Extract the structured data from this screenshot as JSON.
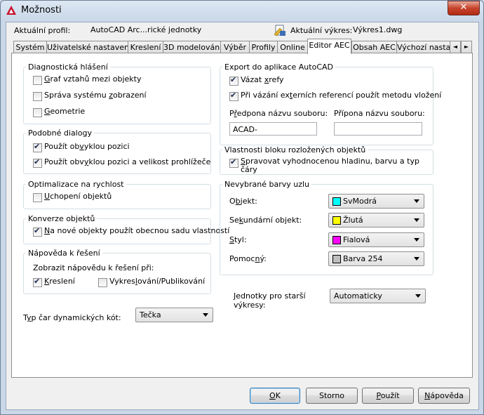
{
  "window": {
    "title": "Možnosti",
    "close_glyph": "✕"
  },
  "header": {
    "profile_label": "Aktuální profil:",
    "profile_value": "AutoCAD Arc...rické jednotky",
    "drawing_label": "Aktuální výkres:",
    "drawing_value": "Výkres1.dwg"
  },
  "tabs": [
    {
      "label": "Systém"
    },
    {
      "label": "Uživatelské nastavení"
    },
    {
      "label": "Kreslení"
    },
    {
      "label": "3D modelování"
    },
    {
      "label": "Výběr"
    },
    {
      "label": "Profily"
    },
    {
      "label": "Online"
    },
    {
      "label": "Editor AEC",
      "active": true
    },
    {
      "label": "Obsah AEC"
    },
    {
      "label": "Výchozí nastavení"
    }
  ],
  "tab_scroll": {
    "left": "◄",
    "right": "►"
  },
  "diag": {
    "title": "Diagnostická hlášení",
    "items": [
      {
        "pre": "",
        "ul": "G",
        "post": "raf vztahů mezi objekty",
        "checked": false
      },
      {
        "pre": "Správa systému ",
        "ul": "z",
        "post": "obrazení",
        "checked": false
      },
      {
        "pre": "",
        "ul": "G",
        "post": "eometrie",
        "checked": false
      }
    ]
  },
  "similar": {
    "title": "Podobné dialogy",
    "items": [
      {
        "pre": "Použít ob",
        "ul": "v",
        "post": "yklou pozici",
        "checked": true
      },
      {
        "pre": "Použít obv",
        "ul": "y",
        "post": "klou pozici a velikost prohlížeče",
        "checked": true
      }
    ]
  },
  "optim": {
    "title": "Optimalizace na rychlost",
    "items": [
      {
        "pre": "",
        "ul": "U",
        "post": "chopení objektů",
        "checked": false
      }
    ]
  },
  "convert": {
    "title": "Konverze objektů",
    "items": [
      {
        "pre": "",
        "ul": "N",
        "post": "a nové objekty použít obecnou sadu vlastností",
        "checked": true
      }
    ]
  },
  "help": {
    "title": "Nápověda k řešení",
    "sub": "Zobrazit nápovědu k řešení při:",
    "items": [
      {
        "pre": "",
        "ul": "K",
        "post": "reslení",
        "checked": true
      },
      {
        "pre": "Vykres",
        "ul": "l",
        "post": "ování/Publikování",
        "checked": false
      }
    ]
  },
  "dimline": {
    "pre": "T",
    "ul": "y",
    "post": "p čar dynamických kót:",
    "value": "Tečka"
  },
  "export": {
    "title": "Export do aplikace AutoCAD",
    "items": [
      {
        "pre": "Vázat ",
        "ul": "x",
        "post": "refy",
        "checked": true
      },
      {
        "pre": "Při vázání ex",
        "ul": "t",
        "post": "erních referencí použít metodu vložení",
        "checked": true
      }
    ],
    "prefix_label": "Předpona názvu souboru:",
    "prefix_ul": "ř",
    "prefix_value": "ACAD-",
    "suffix_label": "Přípona názvu souboru:",
    "suffix_value": ""
  },
  "block": {
    "title": "Vlastnosti bloku rozložených objektů",
    "items": [
      {
        "pre": "",
        "ul": "S",
        "post": "pravovat vyhodnocenou hladinu, barvu a typ čáry",
        "checked": true
      }
    ]
  },
  "colors": {
    "title": "Nevybrané barvy uzlu",
    "rows": [
      {
        "pre": "O",
        "ul": "b",
        "post": "jekt:",
        "value": "SvModrá",
        "swatch": "#00ffff"
      },
      {
        "pre": "Se",
        "ul": "k",
        "post": "undární objekt:",
        "value": "Žlutá",
        "swatch": "#ffff00"
      },
      {
        "pre": "",
        "ul": "S",
        "post": "tyl:",
        "value": "Fialová",
        "swatch": "#ff00ff"
      },
      {
        "pre": "Pomoc",
        "ul": "n",
        "post": "ý:",
        "value": "Barva 254",
        "swatch": "#bebebe"
      }
    ]
  },
  "units": {
    "pre": "",
    "ul": "J",
    "post": "ednotky pro starší\nvýkresy:",
    "value": "Automaticky"
  },
  "buttons": [
    {
      "pre": "",
      "ul": "O",
      "post": "K",
      "default": true
    },
    {
      "pre": "Storno",
      "ul": "",
      "post": ""
    },
    {
      "pre": "",
      "ul": "P",
      "post": "oužít"
    },
    {
      "pre": "",
      "ul": "N",
      "post": "ápověda"
    }
  ]
}
